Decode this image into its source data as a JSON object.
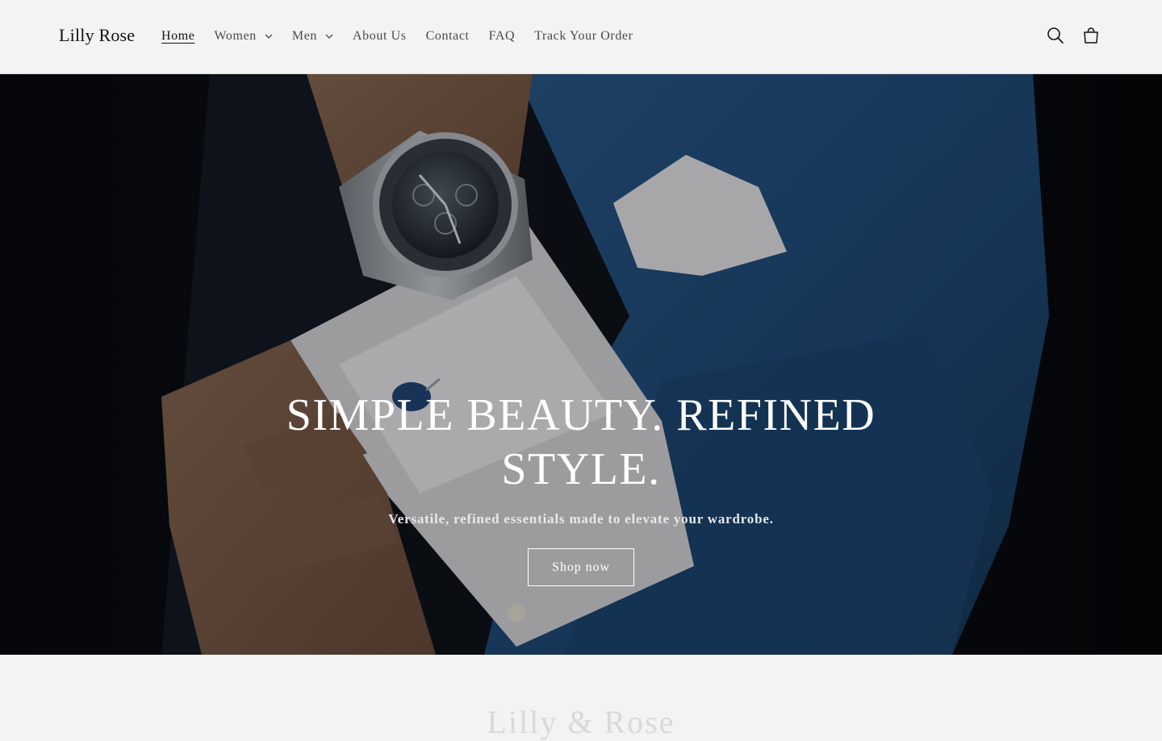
{
  "header": {
    "logo": "Lilly Rose",
    "nav": [
      {
        "label": "Home",
        "active": true,
        "dropdown": false
      },
      {
        "label": "Women",
        "active": false,
        "dropdown": true
      },
      {
        "label": "Men",
        "active": false,
        "dropdown": true
      },
      {
        "label": "About Us",
        "active": false,
        "dropdown": false
      },
      {
        "label": "Contact",
        "active": false,
        "dropdown": false
      },
      {
        "label": "FAQ",
        "active": false,
        "dropdown": false
      },
      {
        "label": "Track Your Order",
        "active": false,
        "dropdown": false
      }
    ],
    "icons": {
      "search": "search-icon",
      "cart": "cart-icon"
    }
  },
  "hero": {
    "title": "SIMPLE BEAUTY. REFINED STYLE.",
    "subtitle": "Versatile, refined essentials made to elevate your wardrobe.",
    "button_label": "Shop now",
    "image": "man in navy suit adjusting shirt cuff with wristwatch and cufflink"
  },
  "next_section": {
    "title": "Lilly & Rose"
  },
  "colors": {
    "background": "#f3f3f3",
    "text": "#121212",
    "hero_text": "#ffffff",
    "suit_blue": "#1f4a78"
  }
}
